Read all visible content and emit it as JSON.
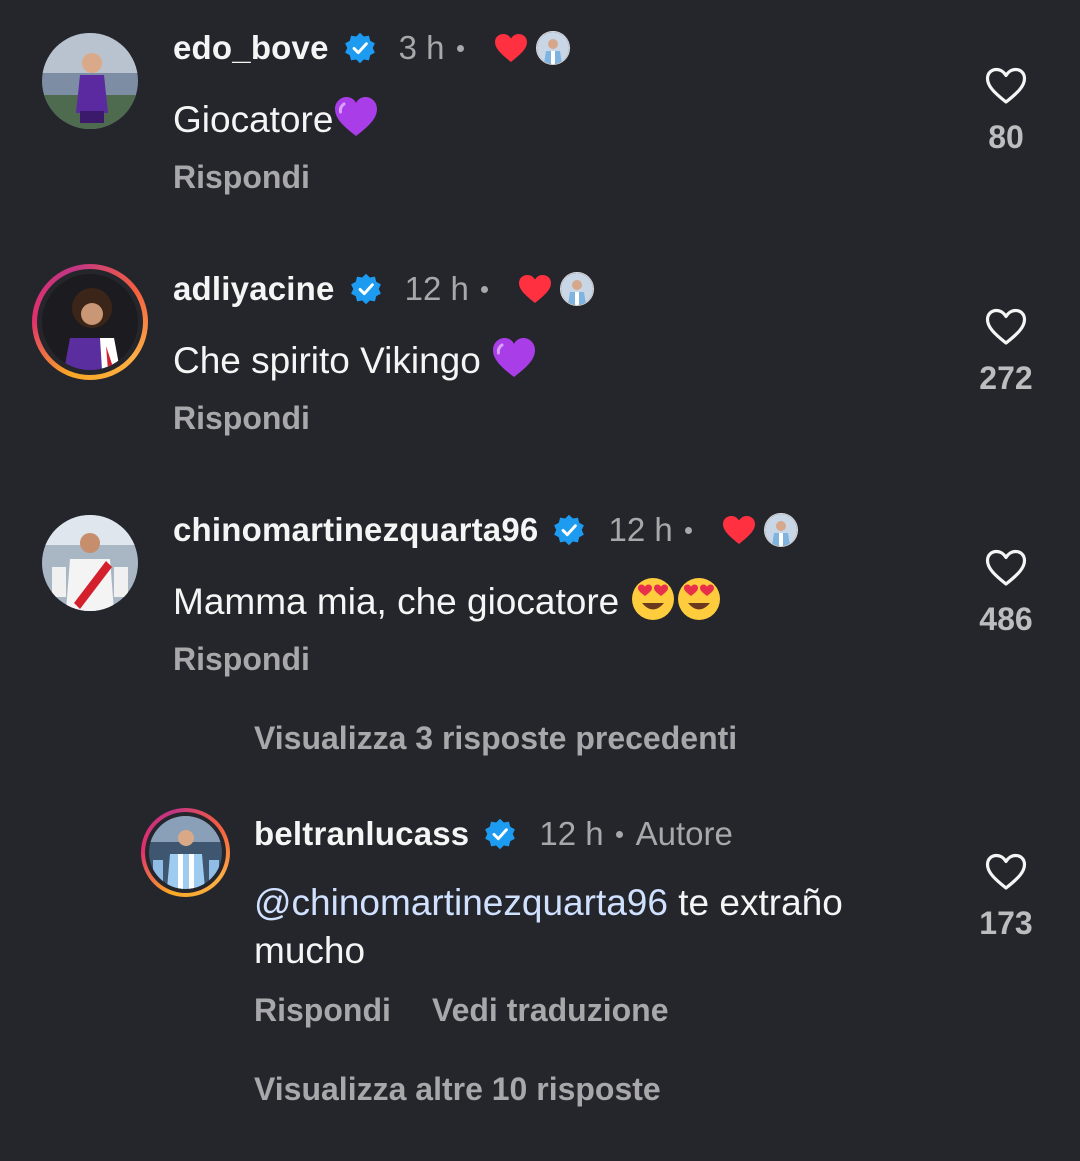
{
  "comments": [
    {
      "username": "edo_bove",
      "time": "3 h",
      "text": "Giocatore",
      "emoji": "purple-heart",
      "reply_label": "Rispondi",
      "likes": "80"
    },
    {
      "username": "adliyacine",
      "time": "12 h",
      "text": "Che spirito Vikingo ",
      "emoji": "purple-heart",
      "reply_label": "Rispondi",
      "likes": "272"
    },
    {
      "username": "chinomartinezquarta96",
      "time": "12 h",
      "text": "Mamma mia, che giocatore ",
      "emoji": "heart-eyes-face x2",
      "reply_label": "Rispondi",
      "likes": "486"
    }
  ],
  "view_previous_replies": "Visualizza 3 risposte precedenti",
  "reply": {
    "username": "beltranlucass",
    "time": "12 h",
    "author_tag": "Autore",
    "mention": "@chinomartinezquarta96",
    "text_after_mention": " te extraño",
    "text_line2": "mucho",
    "reply_label": "Rispondi",
    "translate_label": "Vedi traduzione",
    "likes": "173"
  },
  "view_more_replies": "Visualizza altre 10 risposte",
  "colors": {
    "background": "#25262b",
    "verified_blue": "#1d9bf0",
    "liked_red": "#ff3040",
    "muted_text": "#a8a8ab",
    "mention": "#cfe1ff"
  }
}
